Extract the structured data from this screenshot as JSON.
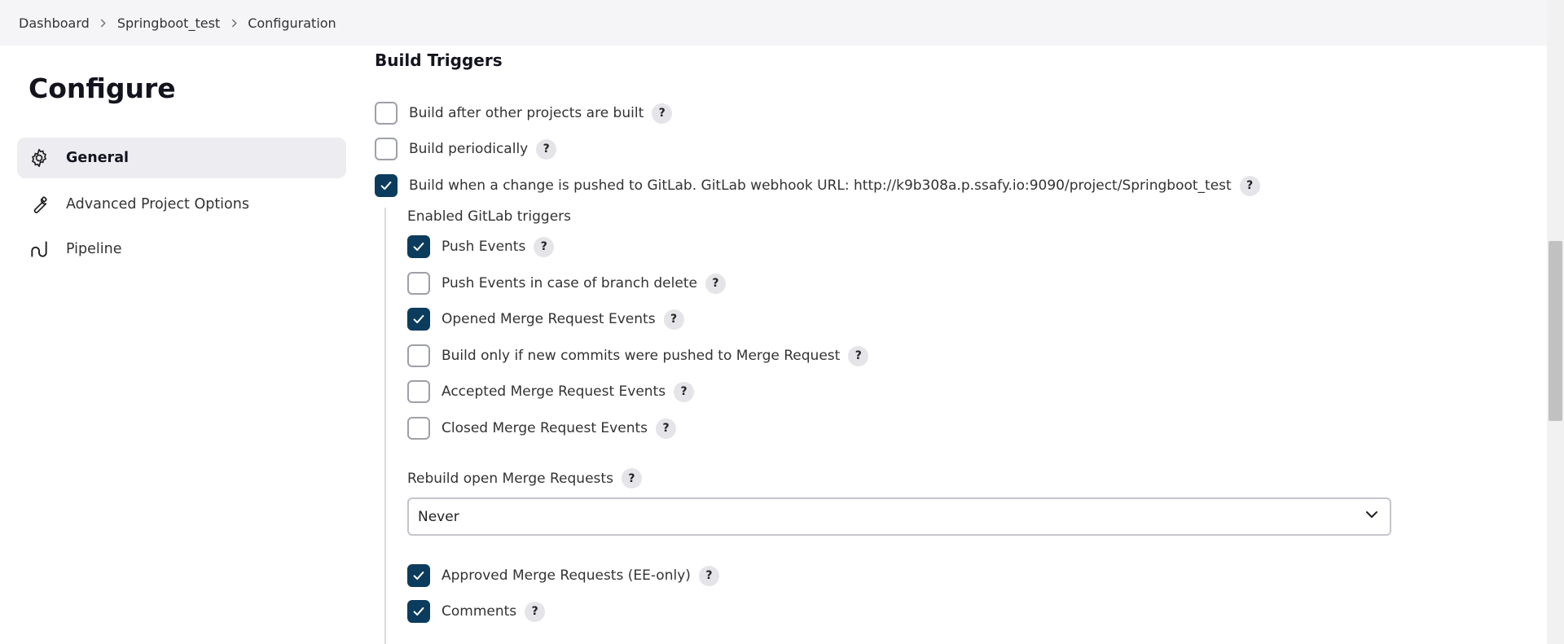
{
  "breadcrumb": {
    "items": [
      "Dashboard",
      "Springboot_test",
      "Configuration"
    ]
  },
  "page": {
    "title": "Configure"
  },
  "sidebar": {
    "items": [
      {
        "label": "General",
        "icon": "gear-icon",
        "active": true
      },
      {
        "label": "Advanced Project Options",
        "icon": "wrench-icon",
        "active": false
      },
      {
        "label": "Pipeline",
        "icon": "pipeline-icon",
        "active": false
      }
    ]
  },
  "build_triggers": {
    "title": "Build Triggers",
    "options": [
      {
        "label": "Build after other projects are built",
        "checked": false
      },
      {
        "label": "Build periodically",
        "checked": false
      },
      {
        "label": "Build when a change is pushed to GitLab. GitLab webhook URL: http://k9b308a.p.ssafy.io:9090/project/Springboot_test",
        "checked": true
      }
    ],
    "gitlab": {
      "subtitle": "Enabled GitLab triggers",
      "triggers": [
        {
          "label": "Push Events",
          "checked": true
        },
        {
          "label": "Push Events in case of branch delete",
          "checked": false
        },
        {
          "label": "Opened Merge Request Events",
          "checked": true
        },
        {
          "label": "Build only if new commits were pushed to Merge Request",
          "checked": false
        },
        {
          "label": "Accepted Merge Request Events",
          "checked": false
        },
        {
          "label": "Closed Merge Request Events",
          "checked": false
        }
      ],
      "rebuild_label": "Rebuild open Merge Requests",
      "rebuild_value": "Never",
      "extra": [
        {
          "label": "Approved Merge Requests (EE-only)",
          "checked": true
        },
        {
          "label": "Comments",
          "checked": true
        }
      ]
    }
  },
  "help_symbol": "?",
  "colors": {
    "checkbox_checked": "#0b3c5d",
    "active_nav_bg": "#ececf1",
    "topbar_bg": "#f5f5f7"
  }
}
